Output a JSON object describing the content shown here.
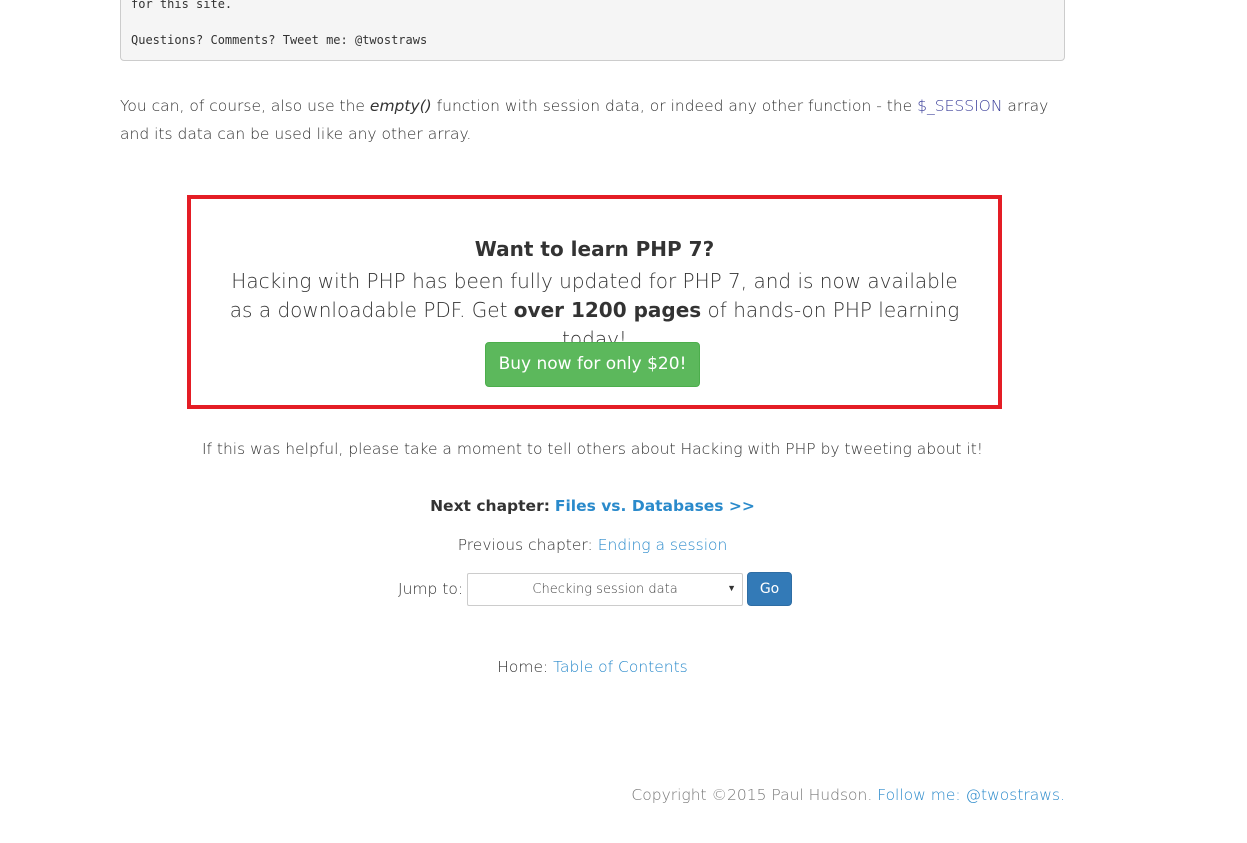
{
  "code_block": {
    "line1": "for this site.",
    "line2": "Questions? Comments? Tweet me: @twostraws"
  },
  "paragraph": {
    "part1": "You can, of course, also use the ",
    "func": "empty()",
    "part2": " function with session data, or indeed any other function - the ",
    "session_var": "$_SESSION",
    "part3": " array and its data can be used like any other array."
  },
  "promo": {
    "title": "Want to learn PHP 7?",
    "body_part1": "Hacking with PHP has been fully updated for PHP 7, and is now available as a downloadable PDF. Get ",
    "body_bold": "over 1200 pages",
    "body_part2": " of hands-on PHP learning today!",
    "button_label": "Buy now for only $20!",
    "border_color": "#e41d25",
    "button_color": "#5cb85c"
  },
  "helpful_text": "If this was helpful, please take a moment to tell others about Hacking with PHP by tweeting about it!",
  "navigation": {
    "next_label": "Next chapter:",
    "next_link": "Files vs. Databases >>",
    "prev_label": "Previous chapter:",
    "prev_link": "Ending a session",
    "jump_label": "Jump to:",
    "jump_selected": "Checking session data",
    "go_label": "Go",
    "home_label": "Home:",
    "home_link": "Table of Contents"
  },
  "footer": {
    "copyright": "Copyright ©2015 Paul Hudson.",
    "follow_label": "Follow me:",
    "handle": "@twostraws",
    "period": "."
  }
}
